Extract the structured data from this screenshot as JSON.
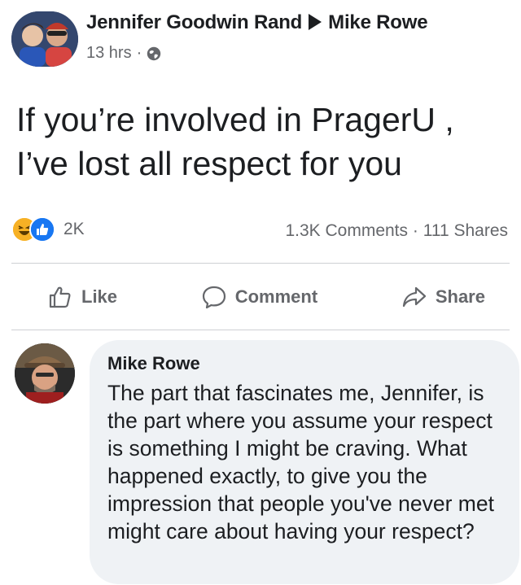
{
  "post": {
    "author": "Jennifer Goodwin Rand",
    "recipient": "Mike Rowe",
    "time": "13 hrs",
    "separator": "·",
    "privacy_icon": "globe-icon",
    "text_line1": "If you’re involved in PragerU ,",
    "text_line2": "I’ve lost all respect for you"
  },
  "stats": {
    "reaction_icons": [
      "haha-reaction-icon",
      "like-reaction-icon"
    ],
    "reaction_count": "2K",
    "comments": "1.3K Comments",
    "dot": "·",
    "shares": "111 Shares"
  },
  "actions": {
    "like": "Like",
    "comment": "Comment",
    "share": "Share"
  },
  "comment": {
    "author": "Mike Rowe",
    "text": "The part that fascinates me, Jennifer, is the part where you assume your respect is something I might be craving. What happened exactly, to give you the impression that people you've never met might care about having your respect?"
  },
  "colors": {
    "text": "#1c1e21",
    "secondary": "#65676b",
    "like_blue": "#1877f2",
    "haha_yellow": "#f7b125",
    "bubble": "#eff2f5",
    "divider": "#ced0d4"
  }
}
